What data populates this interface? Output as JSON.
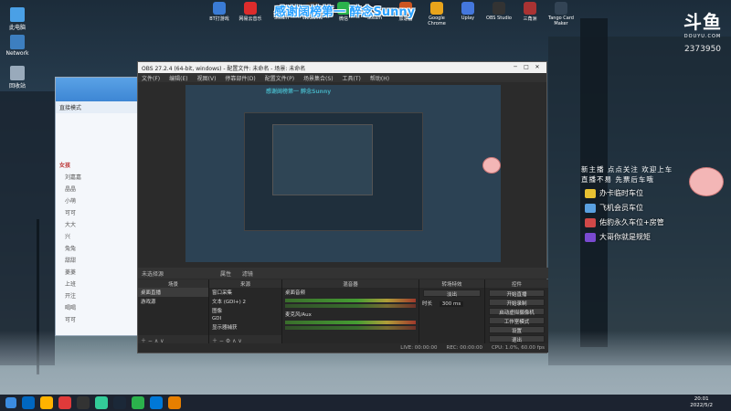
{
  "desktop_icons": [
    {
      "label": "此电脑"
    },
    {
      "label": "Network"
    },
    {
      "label": "回收站"
    }
  ],
  "top_icons": [
    {
      "label": "BT打游戏",
      "color": "#3a7bd5"
    },
    {
      "label": "网易云音乐",
      "color": "#dd2c2c"
    },
    {
      "label": "Steam",
      "color": "#1b2838"
    },
    {
      "label": "WeGame",
      "color": "#2d2d2d"
    },
    {
      "label": "微信",
      "color": "#2bb24c"
    },
    {
      "label": "Steam",
      "color": "#1b2838"
    },
    {
      "label": "加速器",
      "color": "#c52"
    },
    {
      "label": "Google Chrome",
      "color": "#e9a41b"
    },
    {
      "label": "Uplay",
      "color": "#4477dd"
    },
    {
      "label": "OBS Studio",
      "color": "#333"
    },
    {
      "label": "三角洲",
      "color": "#a33"
    },
    {
      "label": "Tango Card Maker",
      "color": "#345"
    }
  ],
  "banner": "感谢阔榜第一 醉念Sunny",
  "douyu": {
    "logo": "斗鱼",
    "sub": "DOUYU.COM",
    "room": "2373950"
  },
  "qq": {
    "mode": "直接模式",
    "groups": [
      {
        "name": "女孩",
        "items": [
          "刘嘉嘉",
          "晶晶",
          "小萌",
          "可可",
          "大大",
          "兴"
        ]
      },
      {
        "name": "",
        "items": [
          "兔兔",
          "甜甜",
          "菱菱",
          "上班",
          "开注",
          "喝喝",
          "可可"
        ]
      }
    ]
  },
  "obs": {
    "title": "OBS 27.2.4 (64-bit, windows) - 配置文件: 未命名 - 场景: 未命名",
    "menu": [
      "文件(F)",
      "编辑(E)",
      "视图(V)",
      "停靠部件(D)",
      "配置文件(P)",
      "场景集合(S)",
      "工具(T)",
      "帮助(H)"
    ],
    "preview_banner": "感谢阔榜第一 醉念Sunny",
    "scene_bar": "未选择源",
    "scene_bar_btns": [
      "属性",
      "滤镜"
    ],
    "docks": {
      "scenes": {
        "header": "场景",
        "items": [
          "桌面直播",
          "游戏源"
        ]
      },
      "sources": {
        "header": "来源",
        "items": [
          "窗口采集",
          "文本 (GDI+) 2",
          "图像",
          "GDI",
          "显示器捕获"
        ]
      },
      "mixer": {
        "header": "混音器",
        "tracks": [
          "桌面音频",
          "麦克风/Aux"
        ]
      },
      "transitions": {
        "header": "转场特效",
        "fade": "淡出",
        "duration_label": "时长",
        "duration": "300 ms"
      },
      "controls": {
        "header": "控件",
        "buttons": [
          "开始直播",
          "开始录制",
          "启动虚拟摄像机",
          "工作室模式",
          "设置",
          "退出"
        ]
      }
    },
    "status": {
      "live": "LIVE: 00:00:00",
      "rec": "REC: 00:00:00",
      "cpu": "CPU: 1.0%, 60.00 fps"
    }
  },
  "overlay": {
    "notice_line1": "新主播 点点关注 欢迎上车",
    "notice_line2": "直播不易 先票后车哦",
    "perks": [
      {
        "text": "办卡临时车位",
        "color": "#e8c132"
      },
      {
        "text": "飞机会员车位",
        "color": "#5aa0e0"
      },
      {
        "text": "佑豹永久车位+房管",
        "color": "#d04848"
      },
      {
        "text": "大哥你就是规矩",
        "color": "#7a4ad0"
      }
    ]
  },
  "taskbar": {
    "icons": [
      "#0067c0",
      "#ffb300",
      "#e03a3a",
      "#333",
      "#3c9",
      "#1b2838",
      "#2bb24c",
      "#0078d7",
      "#e77f00"
    ],
    "time": "20:01",
    "date": "2022/5/2"
  }
}
